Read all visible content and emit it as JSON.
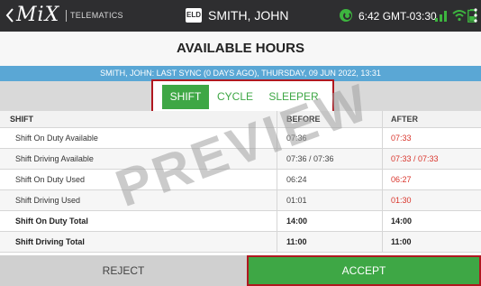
{
  "statusbar": {
    "logo": "MiX",
    "logo_sub": "TELEMATICS",
    "eld_badge": "ELD",
    "driver_name": "SMITH, JOHN",
    "time": "6:42 GMT-03:30"
  },
  "page": {
    "title": "AVAILABLE HOURS",
    "sync_info": "SMITH, JOHN: LAST SYNC (0 DAYS AGO), THURSDAY, 09 JUN 2022, 13:31"
  },
  "tabs": [
    {
      "label": "SHIFT",
      "active": true
    },
    {
      "label": "CYCLE",
      "active": false
    },
    {
      "label": "SLEEPER",
      "active": false
    }
  ],
  "table": {
    "headers": {
      "label": "SHIFT",
      "before": "BEFORE",
      "after": "AFTER"
    },
    "rows": [
      {
        "label": "Shift On Duty Available",
        "before": "07:36",
        "after": "07:33"
      },
      {
        "label": "Shift Driving Available",
        "before": "07:36 / 07:36",
        "after": "07:33 / 07:33"
      },
      {
        "label": "Shift On Duty Used",
        "before": "06:24",
        "after": "06:27"
      },
      {
        "label": "Shift Driving Used",
        "before": "01:01",
        "after": "01:30"
      },
      {
        "label": "Shift On Duty Total",
        "before": "14:00",
        "after": "14:00"
      },
      {
        "label": "Shift Driving Total",
        "before": "11:00",
        "after": "11:00"
      }
    ]
  },
  "watermark": "PREVIEW",
  "actions": {
    "reject": "REJECT",
    "accept": "ACCEPT"
  },
  "colors": {
    "accent_green": "#3ea745",
    "highlight_red": "#b01820",
    "value_red": "#d9342b",
    "sync_blue": "#5aa7d5",
    "topbar": "#2e2e30"
  },
  "icons": [
    "back-chevron-icon",
    "eld-icon",
    "sync-icon",
    "signal-icon",
    "wifi-icon",
    "battery-icon",
    "more-vert-icon"
  ]
}
